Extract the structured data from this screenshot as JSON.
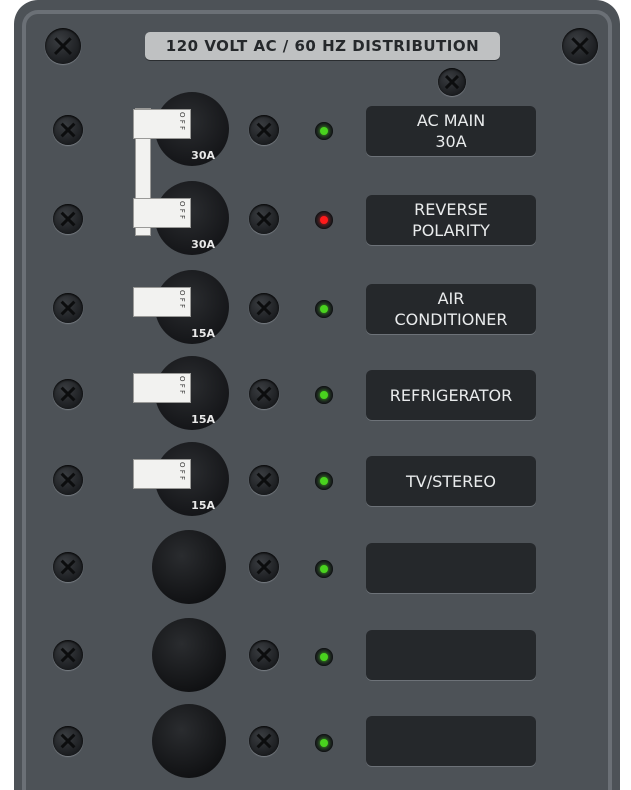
{
  "panel": {
    "title": "120 VOLT AC / 60 HZ DISTRIBUTION"
  },
  "colors": {
    "led_green": "#49d21e",
    "led_red": "#ff1a1a",
    "panel": "#4d5257",
    "label_plate": "#25282b"
  },
  "circuits": [
    {
      "label": "AC MAIN\n30A",
      "breaker_rating": "30A",
      "toggle_text": "O F F",
      "led": "green"
    },
    {
      "label": "REVERSE\nPOLARITY",
      "breaker_rating": "30A",
      "toggle_text": "O F F",
      "led": "red"
    },
    {
      "label": "AIR\nCONDITIONER",
      "breaker_rating": "15A",
      "toggle_text": "O F F",
      "led": "green"
    },
    {
      "label": "REFRIGERATOR",
      "breaker_rating": "15A",
      "toggle_text": "O F F",
      "led": "green"
    },
    {
      "label": "TV/STEREO",
      "breaker_rating": "15A",
      "toggle_text": "O F F",
      "led": "green"
    },
    {
      "label": "",
      "led": "green"
    },
    {
      "label": "",
      "led": "green"
    },
    {
      "label": "",
      "led": "green"
    }
  ]
}
